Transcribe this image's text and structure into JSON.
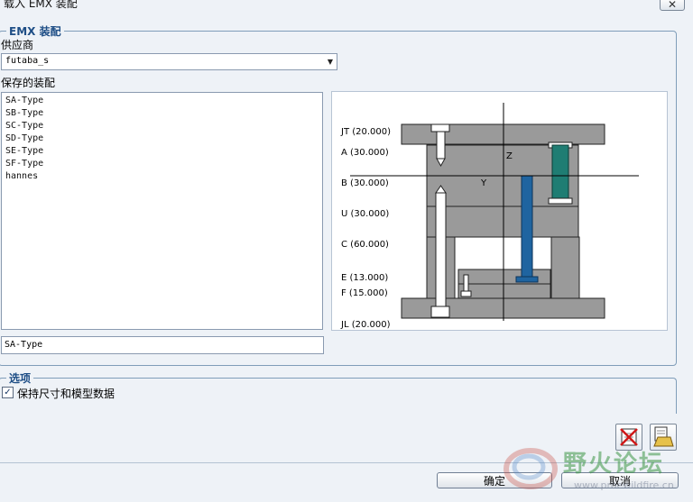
{
  "window": {
    "title": "载入 EMX 装配",
    "close_icon": "✕"
  },
  "assembly_group": {
    "legend": "EMX 装配",
    "supplier_label": "供应商",
    "supplier_value": "futaba_s",
    "saved_label": "保存的装配",
    "saved_items": [
      "SA-Type",
      "SB-Type",
      "SC-Type",
      "SD-Type",
      "SE-Type",
      "SF-Type",
      "hannes"
    ],
    "name_value": "SA-Type"
  },
  "preview": {
    "plates": [
      {
        "key": "JT",
        "label": "JT (20.000)"
      },
      {
        "key": "A",
        "label": "A (30.000)"
      },
      {
        "key": "B",
        "label": "B (30.000)"
      },
      {
        "key": "U",
        "label": "U (30.000)"
      },
      {
        "key": "C",
        "label": "C (60.000)"
      },
      {
        "key": "E",
        "label": "E (13.000)"
      },
      {
        "key": "F",
        "label": "F (15.000)"
      },
      {
        "key": "JL",
        "label": "JL (20.000)"
      }
    ],
    "axis_z": "Z",
    "axis_y": "Y",
    "colors": {
      "plate": "#9a9a9a",
      "pin": "#1f64a0",
      "bushing": "#1f7d73"
    }
  },
  "options_group": {
    "legend": "选项",
    "keep_data_label": "保持尺寸和模型数据",
    "keep_data_checked": "✓"
  },
  "buttons": {
    "ok": "确定",
    "cancel": "取消"
  },
  "watermark": {
    "cn": "野火论坛",
    "en": "www.proewildfire.cn"
  }
}
